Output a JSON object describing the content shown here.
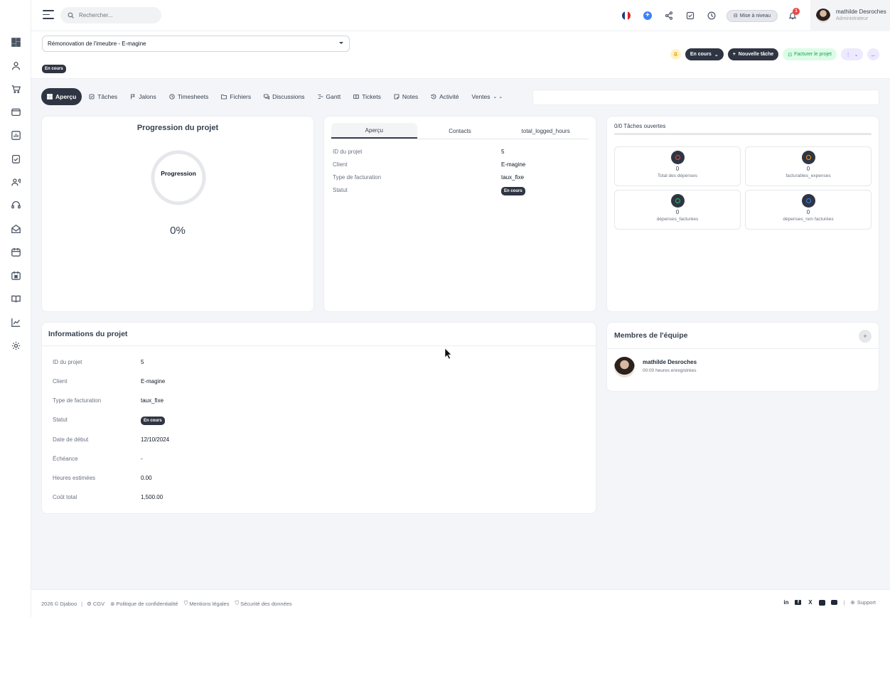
{
  "topbar": {
    "search_placeholder": "Rechercher...",
    "upgrade_label": "Mise à niveau",
    "notification_count": "1",
    "user_name": "mathilde Desroches",
    "user_role": "Administrateur"
  },
  "project": {
    "selected": "Rémonovation de l'imeubre - E-magine",
    "status": "En cours",
    "actions": {
      "status_label": "En cours",
      "new_task_label": "Nouvelle tâche",
      "invoice_label": "Facturer le projet"
    }
  },
  "tabs": [
    {
      "label": "Aperçu",
      "icon": "grid-icon"
    },
    {
      "label": "Tâches",
      "icon": "checkbox-icon"
    },
    {
      "label": "Jalons",
      "icon": "flag-icon"
    },
    {
      "label": "Timesheets",
      "icon": "clock-icon"
    },
    {
      "label": "Fichiers",
      "icon": "folder-icon"
    },
    {
      "label": "Discussions",
      "icon": "chat-icon"
    },
    {
      "label": "Gantt",
      "icon": "gantt-icon"
    },
    {
      "label": "Tickets",
      "icon": "ticket-icon"
    },
    {
      "label": "Notes",
      "icon": "note-icon"
    },
    {
      "label": "Activité",
      "icon": "history-icon"
    },
    {
      "label": "Ventes",
      "icon": "chevron-down-icon"
    }
  ],
  "progress": {
    "title": "Progression du projet",
    "ring_label": "Progression",
    "value_text": "0%",
    "fraction": 0
  },
  "overview": {
    "subtabs": [
      "Aperçu",
      "Contacts",
      "total_logged_hours"
    ],
    "rows": [
      {
        "k": "ID du projet",
        "v": "5"
      },
      {
        "k": "Client",
        "v": "E-magine"
      },
      {
        "k": "Type de facturation",
        "v": "taux_fixe"
      },
      {
        "k": "Statut",
        "v": "En cours"
      }
    ]
  },
  "tasks": {
    "title": "0/0 Tâches ouvertes",
    "stats": [
      {
        "value": "0",
        "label": "Total des dépenses",
        "color": "#ef4444"
      },
      {
        "value": "0",
        "label": "facturables_expenses",
        "color": "#f59e0b"
      },
      {
        "value": "0",
        "label": "dépenses_facturées",
        "color": "#22c55e"
      },
      {
        "value": "0",
        "label": "dépenses_non facturées",
        "color": "#3b82f6"
      }
    ]
  },
  "info": {
    "title": "Informations du projet",
    "rows": [
      {
        "k": "ID du projet",
        "v": "5"
      },
      {
        "k": "Client",
        "v": "E-magine"
      },
      {
        "k": "Type de facturation",
        "v": "taux_fixe"
      },
      {
        "k": "Statut",
        "v": "En cours"
      },
      {
        "k": "Date de début",
        "v": "12/10/2024"
      },
      {
        "k": "Échéance",
        "v": "-"
      },
      {
        "k": "Heures estimées",
        "v": "0.00"
      },
      {
        "k": "Coût total",
        "v": "1,500.00"
      }
    ]
  },
  "team": {
    "title": "Membres de l'équipe",
    "add_label": "+",
    "members": [
      {
        "name": "mathilde Desroches",
        "hours": "00:00 heures enregistrées"
      }
    ]
  },
  "footer": {
    "copyright": "2026 © Djaboo",
    "links": [
      "CGV",
      "Politique de confidentialité",
      "Mentions légales",
      "Sécurité des données"
    ],
    "social": [
      "in",
      "f",
      "X",
      "ig",
      "yt"
    ],
    "support": "Support"
  }
}
